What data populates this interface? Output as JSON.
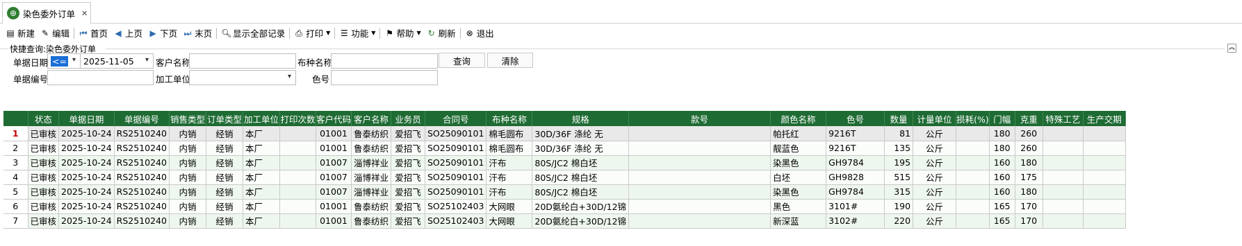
{
  "tab": {
    "title": "染色委外订单",
    "close": "✕"
  },
  "toolbar": {
    "new": "新建",
    "edit": "编辑",
    "first": "首页",
    "prev": "上页",
    "next": "下页",
    "last": "末页",
    "show_all": "显示全部记录",
    "print": "打印",
    "functions": "功能",
    "help": "帮助",
    "refresh": "刷新",
    "exit": "退出"
  },
  "quick_query": {
    "title": "快捷查询:染色委外订单",
    "date_label": "单据日期",
    "date_op": "<=",
    "date_value": "2025-11-05",
    "customer_label": "客户名称",
    "customer_value": "",
    "fabric_label": "布种名称",
    "fabric_value": "",
    "doc_no_label": "单据编号",
    "doc_no_value": "",
    "processor_label": "加工单位",
    "processor_value": "",
    "color_no_label": "色号",
    "color_no_value": "",
    "query_button": "查询",
    "clear_button": "清除"
  },
  "grid": {
    "headers": [
      "状态",
      "单据日期",
      "单据编号",
      "销售类型",
      "订单类型",
      "加工单位",
      "打印次数",
      "客户代码",
      "客户名称",
      "业务员",
      "合同号",
      "布种名称",
      "规格",
      "款号",
      "颜色名称",
      "色号",
      "数量",
      "计量单位",
      "损耗(%)",
      "门幅",
      "克重",
      "特殊工艺",
      "生产交期"
    ],
    "rows": [
      {
        "n": "1",
        "status": "已审核",
        "date": "2025-10-24",
        "doc": "RS2510240",
        "sale": "内销",
        "order": "经销",
        "proc": "本厂",
        "print": "",
        "code": "01001",
        "cust": "鲁泰纺织",
        "sales": "爱招飞",
        "contract": "SO25090101",
        "fabric": "棉毛圆布",
        "spec": "30D/36F  涤纶  无",
        "style": "",
        "color": "帕托红",
        "color_no": "9216T",
        "qty": "81",
        "unit": "公斤",
        "loss": "",
        "width": "180",
        "weight": "260",
        "special": "",
        "delivery": ""
      },
      {
        "n": "2",
        "status": "已审核",
        "date": "2025-10-24",
        "doc": "RS2510240",
        "sale": "内销",
        "order": "经销",
        "proc": "本厂",
        "print": "",
        "code": "01001",
        "cust": "鲁泰纺织",
        "sales": "爱招飞",
        "contract": "SO25090101",
        "fabric": "棉毛圆布",
        "spec": "30D/36F  涤纶  无",
        "style": "",
        "color": "靓蓝色",
        "color_no": "9216T",
        "qty": "135",
        "unit": "公斤",
        "loss": "",
        "width": "180",
        "weight": "260",
        "special": "",
        "delivery": ""
      },
      {
        "n": "3",
        "status": "已审核",
        "date": "2025-10-24",
        "doc": "RS2510240",
        "sale": "内销",
        "order": "经销",
        "proc": "本厂",
        "print": "",
        "code": "01007",
        "cust": "淄博祥业",
        "sales": "爱招飞",
        "contract": "SO25090101",
        "fabric": "汗布",
        "spec": "80S/JC2  棉白坯",
        "style": "",
        "color": "染黑色",
        "color_no": "GH9784",
        "qty": "195",
        "unit": "公斤",
        "loss": "",
        "width": "160",
        "weight": "180",
        "special": "",
        "delivery": ""
      },
      {
        "n": "4",
        "status": "已审核",
        "date": "2025-10-24",
        "doc": "RS2510240",
        "sale": "内销",
        "order": "经销",
        "proc": "本厂",
        "print": "",
        "code": "01007",
        "cust": "淄博祥业",
        "sales": "爱招飞",
        "contract": "SO25090101",
        "fabric": "汗布",
        "spec": "80S/JC2  棉白坯",
        "style": "",
        "color": "白坯",
        "color_no": "GH9828",
        "qty": "515",
        "unit": "公斤",
        "loss": "",
        "width": "160",
        "weight": "175",
        "special": "",
        "delivery": ""
      },
      {
        "n": "5",
        "status": "已审核",
        "date": "2025-10-24",
        "doc": "RS2510240",
        "sale": "内销",
        "order": "经销",
        "proc": "本厂",
        "print": "",
        "code": "01007",
        "cust": "淄博祥业",
        "sales": "爱招飞",
        "contract": "SO25090101",
        "fabric": "汗布",
        "spec": "80S/JC2  棉白坯",
        "style": "",
        "color": "染黑色",
        "color_no": "GH9784",
        "qty": "315",
        "unit": "公斤",
        "loss": "",
        "width": "160",
        "weight": "180",
        "special": "",
        "delivery": ""
      },
      {
        "n": "6",
        "status": "已审核",
        "date": "2025-10-24",
        "doc": "RS2510240",
        "sale": "内销",
        "order": "经销",
        "proc": "本厂",
        "print": "",
        "code": "01001",
        "cust": "鲁泰纺织",
        "sales": "爱招飞",
        "contract": "SO25102403",
        "fabric": "大网眼",
        "spec": "20D氨纶白+30D/12锦",
        "style": "",
        "color": "黑色",
        "color_no": "3101#",
        "qty": "190",
        "unit": "公斤",
        "loss": "",
        "width": "165",
        "weight": "170",
        "special": "",
        "delivery": ""
      },
      {
        "n": "7",
        "status": "已审核",
        "date": "2025-10-24",
        "doc": "RS2510240",
        "sale": "内销",
        "order": "经销",
        "proc": "本厂",
        "print": "",
        "code": "01001",
        "cust": "鲁泰纺织",
        "sales": "爱招飞",
        "contract": "SO25102403",
        "fabric": "大网眼",
        "spec": "20D氨纶白+30D/12锦",
        "style": "",
        "color": "新深蓝",
        "color_no": "3102#",
        "qty": "220",
        "unit": "公斤",
        "loss": "",
        "width": "165",
        "weight": "170",
        "special": "",
        "delivery": ""
      }
    ]
  }
}
